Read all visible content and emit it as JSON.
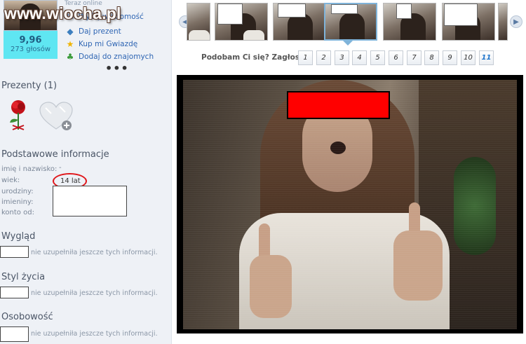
{
  "watermark": {
    "text": "www.wiocha.pl"
  },
  "profile": {
    "online_status": "Teraz online",
    "rating_value": "9,96",
    "rating_votes": "273 głosów",
    "more": "•••"
  },
  "actions": [
    {
      "label": "Wyślij wiadomość",
      "icon": "message-icon"
    },
    {
      "label": "Daj prezent",
      "icon": "gift-icon"
    },
    {
      "label": "Kup mi Gwiazdę",
      "icon": "star-icon"
    },
    {
      "label": "Dodaj do znajomych",
      "icon": "add-friend-icon"
    }
  ],
  "gifts": {
    "title": "Prezenty (1)",
    "items": [
      "rose-gift-icon",
      "add-gift-heart-icon"
    ]
  },
  "basic_info": {
    "title": "Podstawowe informacje",
    "labels": [
      "imię i nazwisko:",
      "wiek:",
      "urodziny:",
      "imieniny:",
      "konto od:"
    ],
    "name_value": "-",
    "age_value": "14 lat"
  },
  "sections": [
    {
      "title": "Wygląd",
      "note": "nie uzupełniła jeszcze tych informacji."
    },
    {
      "title": "Styl życia",
      "note": "nie uzupełniła jeszcze tych informacji."
    },
    {
      "title": "Osobowość",
      "note": "nie uzupełniła jeszcze tych informacji."
    }
  ],
  "gallery": {
    "thumb_count": 6,
    "selected_index": 3
  },
  "voting": {
    "label": "Podobam Ci się? Zagłosuj:",
    "options": [
      "1",
      "2",
      "3",
      "4",
      "5",
      "6",
      "7",
      "8",
      "9",
      "10",
      "11"
    ],
    "highlighted": "11"
  },
  "colors": {
    "rating_bg": "#5fe6f2",
    "link": "#2e65b3",
    "highlight_circle": "#e0171b",
    "photo_redact": "#ff0000"
  }
}
